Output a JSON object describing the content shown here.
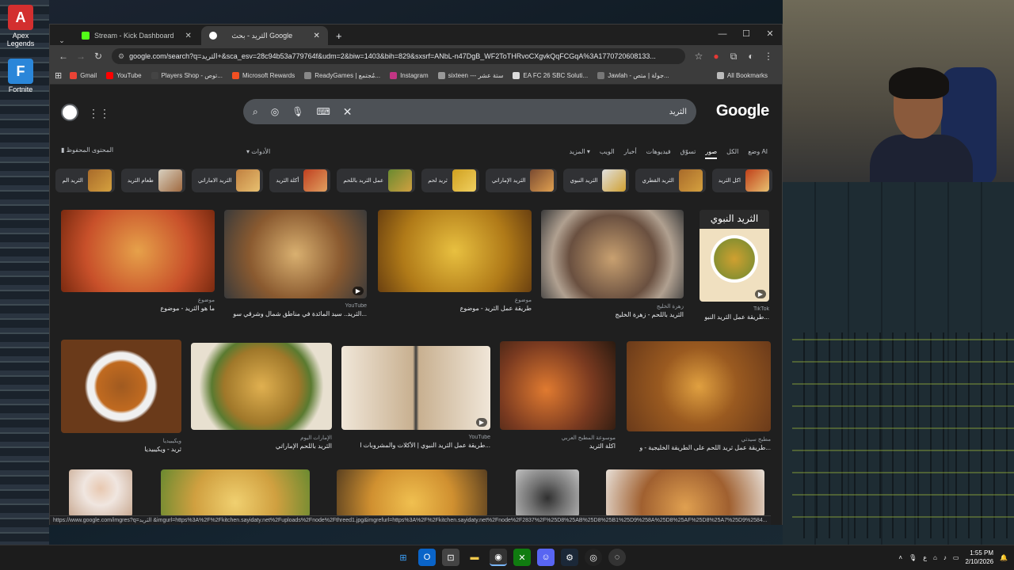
{
  "desktop": {
    "icons": [
      {
        "label": "Apex\nLegends",
        "glyph": "A",
        "color": "#d32f2f"
      },
      {
        "label": "Fortnite",
        "glyph": "F",
        "color": "#2a86d9"
      }
    ]
  },
  "browser": {
    "tabs": [
      {
        "label": "Stream - Kick Dashboard",
        "icon": "kick-icon",
        "color": "#53fc18",
        "active": false
      },
      {
        "label": "الثريد - بحث Google",
        "icon": "google-icon",
        "color": "#ffffff",
        "active": true
      }
    ],
    "new_tab": "+",
    "controls": {
      "minimize": "—",
      "maximize": "☐",
      "close": "✕"
    },
    "url": "google.com/search?q=الثريد+&sca_esv=28c94b53a779764f&udm=2&biw=1403&bih=829&sxsrf=ANbL-n47DgB_WF2ToTHRvoCXgvkQqFCGqA%3A1770720608133...",
    "bookmarks": [
      {
        "label": "Gmail",
        "color": "#ea4335"
      },
      {
        "label": "YouTube",
        "color": "#ff0000"
      },
      {
        "label": "Players Shop - توص...",
        "color": "#444"
      },
      {
        "label": "Microsoft Rewards",
        "color": "#f25022"
      },
      {
        "label": "ReadyGames | مُجتمع...",
        "color": "#888"
      },
      {
        "label": "Instagram",
        "color": "#c13584"
      },
      {
        "label": "sixteen --- ستة عشر",
        "color": "#999"
      },
      {
        "label": "EA FC 26 SBC Soluti...",
        "color": "#ddd"
      },
      {
        "label": "Jawlah - جولة | متص...",
        "color": "#777"
      }
    ],
    "all_bookmarks": "All Bookmarks",
    "status_url": "https://www.google.com/imgres?q=الثريد &imgurl=https%3A%2F%2Fkitchen.sayidaty.net%2Fuploads%2Fnode%2Fthreed1.jpg&imgrefurl=https%3A%2F%2Fkitchen.sayidaty.net%2Fnode%2F2837%2F%25D8%25AB%25D8%25B1%25D9%258A%25D8%25AF%25D8%25A7%25D9%2584..."
  },
  "google": {
    "logo": "Google",
    "query": "الثريد",
    "saved": "المحتوى المحفوظ",
    "tools": "الأدوات",
    "filters": [
      "وضع AI",
      "الكل",
      "صور",
      "صوَر",
      "فيديوهات",
      "أخبار",
      "الويب",
      "المزيد"
    ],
    "chips": [
      "اكل الثريد",
      "الثريد القطري",
      "الثريد النبوي",
      "الثريد الإماراتي",
      "ثريد لحم",
      "عمل الثريد باللحم",
      "أكلة الثريد",
      "الثريد الاماراتي",
      "طعام الثريد",
      "الثريد الم"
    ],
    "row1": [
      {
        "src": "موضوع",
        "cap": "ما هو الثريد - موضوع",
        "c1": "#c8502a",
        "c2": "#e6a14a",
        "video": false
      },
      {
        "src": "YouTube",
        "cap": "الثريد.. سيد المائدة في مناطق شمال وشرقي سو...",
        "c1": "#8a5a30",
        "c2": "#d9b070",
        "video": true
      },
      {
        "src": "موضوع",
        "cap": "طريقة عمل الثريد - موضوع",
        "c1": "#b07a18",
        "c2": "#e8c040",
        "video": false
      },
      {
        "src": "زهرة الخليج",
        "cap": "الثريد باللحم - زهرة الخليج",
        "c1": "#6a5040",
        "c2": "#c8a070",
        "video": false
      },
      {
        "src": "TikTok",
        "cap": "طريقة عمل الثريد النبو...",
        "c1": "#d0a030",
        "c2": "#f0e0c0",
        "video": true,
        "overlay": "الثريد النبوي"
      }
    ],
    "row2": [
      {
        "src": "ويكيبيديا",
        "cap": "ثريد - ويكيبيديا",
        "c1": "#a05a20",
        "c2": "#f0f0f0",
        "video": false
      },
      {
        "src": "الإمارات اليوم",
        "cap": "الثريد باللحم الإماراتي",
        "c1": "#a0782a",
        "c2": "#e0b050",
        "video": false
      },
      {
        "src": "YouTube",
        "cap": "طريقة عمل الثريد النبوي | الأكلات والمشروبات ا...",
        "c1": "#c8b090",
        "c2": "#f0e6d8",
        "video": true
      },
      {
        "src": "موسوعة المطبخ العربي",
        "cap": "اكلة الثريد",
        "c1": "#7a3a20",
        "c2": "#e07a30",
        "video": false
      },
      {
        "src": "مطبخ سيدتي",
        "cap": "طريقة عمل ثريد اللحم على الطريقة الخليجية - و...",
        "c1": "#6a3a1a",
        "c2": "#e0a040",
        "video": false
      }
    ],
    "row3": [
      {
        "c1": "#c8a890",
        "c2": "#f0e6e0"
      },
      {
        "c1": "#d0a040",
        "c2": "#f0d070"
      },
      {
        "c1": "#d09030",
        "c2": "#f0c050"
      },
      {
        "c1": "#303030",
        "c2": "#c0c0c0"
      },
      {
        "c1": "#a06030",
        "c2": "#e0a050"
      }
    ]
  },
  "taskbar": {
    "apps": [
      "windows-icon",
      "outlook-icon",
      "store-icon",
      "files-icon",
      "chrome-icon",
      "xbox-icon",
      "discord-icon",
      "steam-icon",
      "obs-icon",
      "app-icon"
    ],
    "clock_time": "1:55 PM",
    "clock_date": "2/10/2026",
    "lang": "ع"
  }
}
